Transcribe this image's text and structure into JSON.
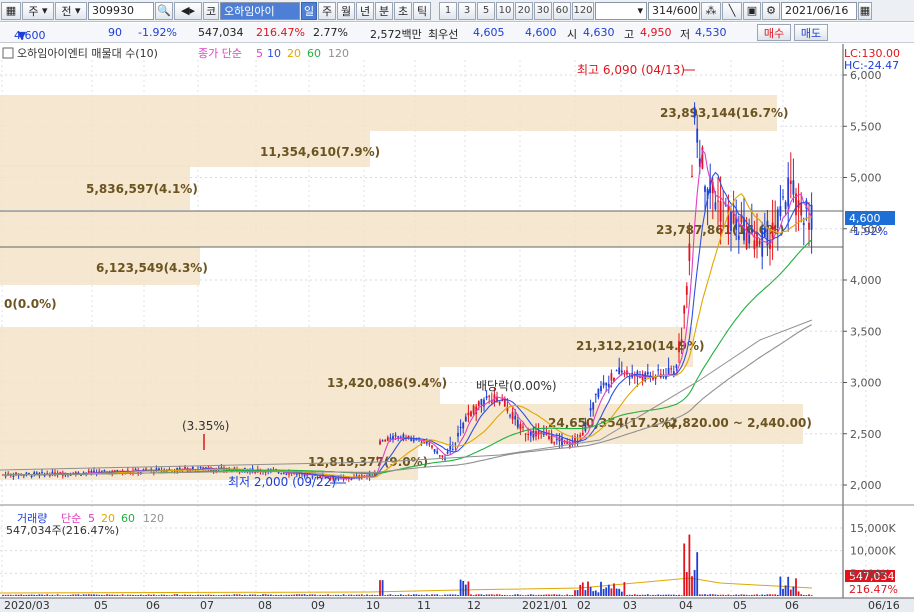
{
  "toolbar": {
    "grid_icon": "grid-icon",
    "market": "주",
    "type": "전",
    "code": "309930",
    "search_icon": "search-icon",
    "sound_icon": "speaker-icon",
    "stock_prefix": "코",
    "stock_name": "오하임아이",
    "periods_active": "일",
    "periods": [
      "주",
      "월",
      "년",
      "분",
      "초",
      "틱"
    ],
    "intervals": [
      "1",
      "3",
      "5",
      "10",
      "20",
      "30",
      "60",
      "120"
    ],
    "count_value": "314",
    "count_total": "/600",
    "date": "2021/06/16"
  },
  "quote": {
    "price": "4,600",
    "arrow": "▼",
    "change": "90",
    "change_pct": "-1.92%",
    "volume": "547,034",
    "vol_ratio": "216.47%",
    "turnover": "2.77%",
    "amount": "2,572백만",
    "best_label": "최우선",
    "best_ask": "4,605",
    "best_bid": "4,600",
    "open_label": "시",
    "open": "4,630",
    "high_label": "고",
    "high": "4,950",
    "low_label": "저",
    "low": "4,530",
    "buy_button": "매수",
    "sell_button": "매도"
  },
  "price_panel": {
    "title": "오하임아이엔티 매물대 수(10)",
    "ma_label": "종가 단순",
    "ma_periods": [
      "5",
      "10",
      "20",
      "60",
      "120"
    ],
    "lc_label": "LC:130.00",
    "hc_label": "HC:-24.47",
    "high_note": "최고 6,090 (04/13)",
    "low_note": "최저 2,000 (09/22)",
    "pct_note": "(3.35%)",
    "dividend_note": "배당락(0.00%)",
    "current_price": "4,600",
    "current_pct": "-1.92%",
    "zone_range": "(2,820.00 ~ 2,440.00)",
    "y_ticks": [
      "6,000",
      "5,500",
      "5,000",
      "4,500",
      "4,000",
      "3,500",
      "3,000",
      "2,500",
      "2,000"
    ],
    "volume_profile": [
      {
        "label": "23,893,144(16.7%)"
      },
      {
        "label": "11,354,610(7.9%)"
      },
      {
        "label": "5,836,597(4.1%)"
      },
      {
        "label": "23,787,861(16.6%)"
      },
      {
        "label": "6,123,549(4.3%)"
      },
      {
        "label": "0(0.0%)"
      },
      {
        "label": "21,312,210(14.9%)"
      },
      {
        "label": "13,420,086(9.4%)"
      },
      {
        "label": "24,650,354(17.2%)"
      },
      {
        "label": "12,819,377(9.0%)"
      }
    ]
  },
  "volume_panel": {
    "title": "거래량",
    "ma_label": "단순",
    "ma_periods": [
      "5",
      "20",
      "60",
      "120"
    ],
    "current": "547,034주(216.47%)",
    "y_ticks": [
      "15,000K",
      "10,000K",
      "5,000K"
    ],
    "current_value": "547,034",
    "current_pct": "216.47%"
  },
  "x_axis": [
    "2020/03",
    "05",
    "06",
    "07",
    "08",
    "09",
    "10",
    "11",
    "12",
    "2021/01",
    "02",
    "03",
    "04",
    "05",
    "06",
    "06/16"
  ],
  "colors": {
    "up": "#e0141e",
    "down": "#1d3fd6",
    "ma5": "#e040c0",
    "ma10": "#3050e0",
    "ma20": "#e0a800",
    "ma60": "#20b040",
    "ma120": "#909090",
    "profile": "#f3e3c8"
  }
}
